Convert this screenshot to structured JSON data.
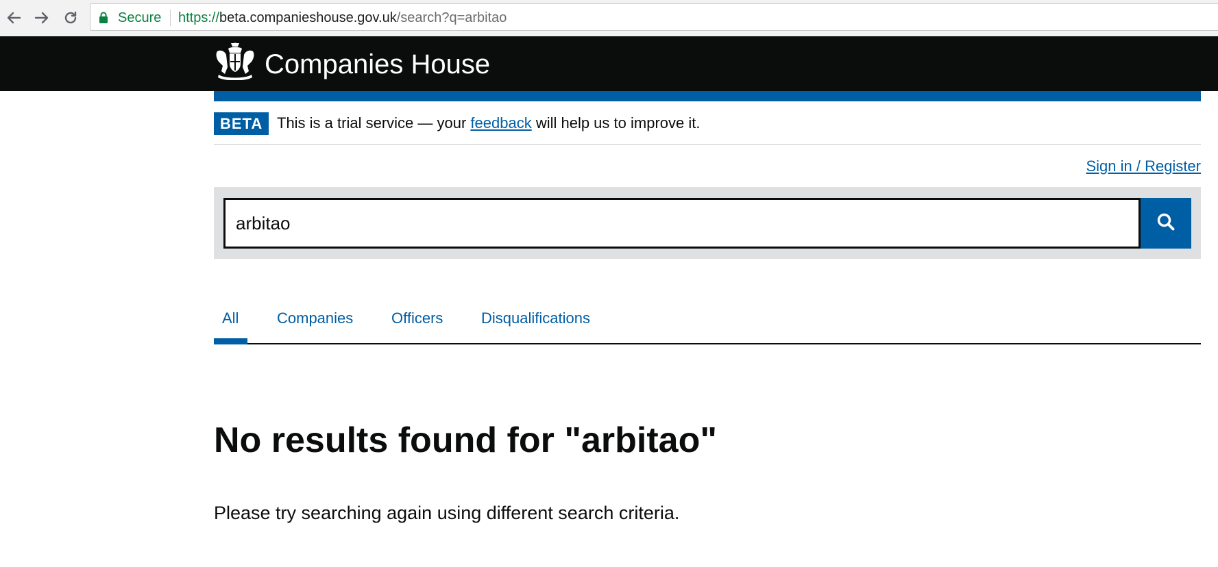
{
  "browser": {
    "secure_label": "Secure",
    "url_scheme": "https://",
    "url_host": "beta.companieshouse.gov.uk",
    "url_path": "/search?q=arbitao"
  },
  "header": {
    "brand": "Companies House"
  },
  "beta_banner": {
    "tag": "BETA",
    "text_before": "This is a trial service — your ",
    "link": "feedback",
    "text_after": " will help us to improve it."
  },
  "account": {
    "signin_label": "Sign in / Register"
  },
  "search": {
    "value": "arbitao"
  },
  "tabs": [
    {
      "label": "All",
      "active": true
    },
    {
      "label": "Companies",
      "active": false
    },
    {
      "label": "Officers",
      "active": false
    },
    {
      "label": "Disqualifications",
      "active": false
    }
  ],
  "results": {
    "heading": "No results found for \"arbitao\"",
    "message": "Please try searching again using different search criteria."
  },
  "colors": {
    "accent": "#005ea5",
    "header_bg": "#0b0c0c",
    "search_bg": "#dee0e2"
  }
}
